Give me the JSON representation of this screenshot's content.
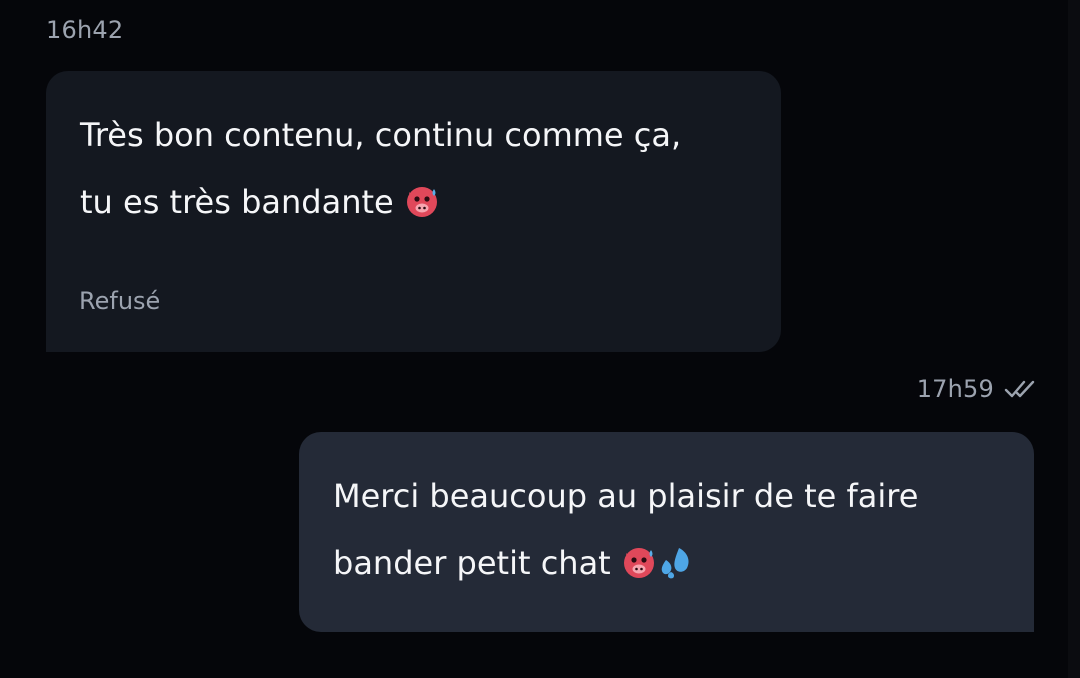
{
  "conversation": {
    "incoming": {
      "time": "16h42",
      "lines": [
        "Très bon contenu, continu comme ça,",
        "tu es très bandante"
      ],
      "line2_emojis": [
        "hot-face-devil-emoji"
      ],
      "status": "Refusé"
    },
    "outgoing": {
      "time": "17h59",
      "read_receipt_icon": "double-check-icon",
      "lines": [
        "Merci beaucoup au plaisir de te faire",
        "bander petit chat"
      ],
      "line2_emojis": [
        "hot-face-devil-emoji",
        "sweat-droplets-emoji"
      ]
    }
  },
  "colors": {
    "background": "#05060a",
    "incoming_bubble": "#141820",
    "outgoing_bubble": "#242a37",
    "muted_text": "#9ca3af",
    "emoji_red": "#e0485a"
  }
}
